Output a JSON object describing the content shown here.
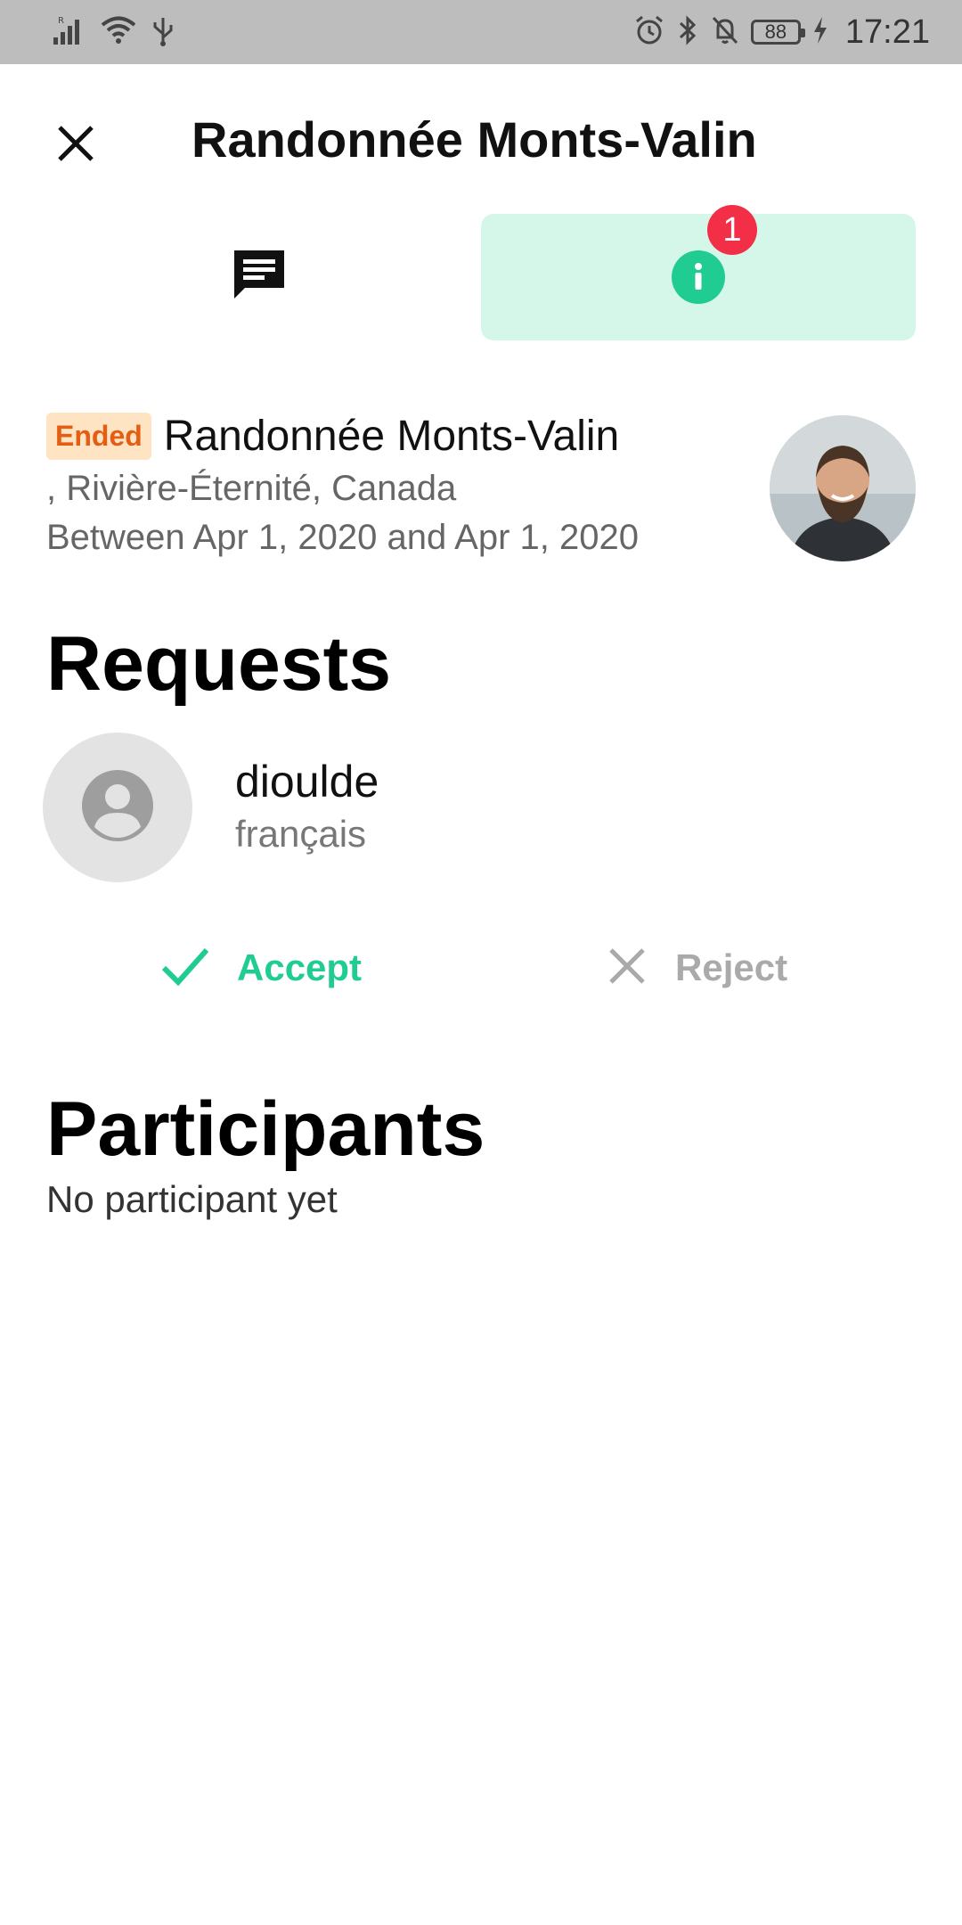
{
  "status_bar": {
    "time": "17:21",
    "battery": "88",
    "left_icons": [
      "signal-icon",
      "wifi-icon",
      "usb-icon"
    ],
    "right_icons": [
      "alarm-icon",
      "bluetooth-icon",
      "bell-off-icon",
      "battery-icon",
      "charging-icon"
    ]
  },
  "header": {
    "title": "Randonnée Monts-Valin",
    "close_icon": "close-icon"
  },
  "tabs": {
    "chat_icon": "chat-icon",
    "info_icon": "info-icon",
    "info_badge": "1",
    "active": "info"
  },
  "event": {
    "status": "Ended",
    "name": "Randonnée Monts-Valin",
    "location": ", Rivière-Éternité, Canada",
    "dates": "Between Apr 1, 2020 and Apr 1, 2020"
  },
  "requests": {
    "title": "Requests",
    "items": [
      {
        "name": "dioulde",
        "language": "français",
        "accept_label": "Accept",
        "reject_label": "Reject"
      }
    ]
  },
  "participants": {
    "title": "Participants",
    "empty_text": "No participant yet"
  },
  "colors": {
    "accent": "#21cc93",
    "info_tab_bg": "#d4f7ea",
    "badge": "#f22f46",
    "ended_tag_bg": "#ffe4c4",
    "ended_tag_text": "#e35e12",
    "status_bar_bg": "#bdbdbd"
  }
}
